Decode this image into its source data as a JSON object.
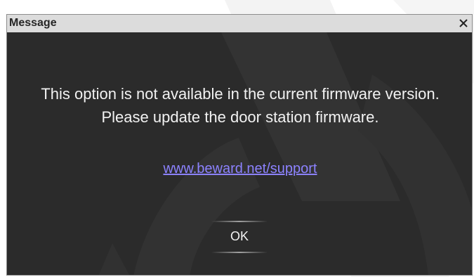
{
  "dialog": {
    "title": "Message",
    "close_glyph": "×",
    "message": "This option is not available in the current firmware version. Please update the door station firmware.",
    "link_text": "www.beward.net/support",
    "ok_label": "OK"
  },
  "icons": {
    "close": "close-icon"
  },
  "colors": {
    "titlebar": "#dcdcdc",
    "dialog_background": "#2b2b2b",
    "text": "#f2f2f2",
    "link": "#8c82ff",
    "watermark": "#f1f1f1"
  }
}
